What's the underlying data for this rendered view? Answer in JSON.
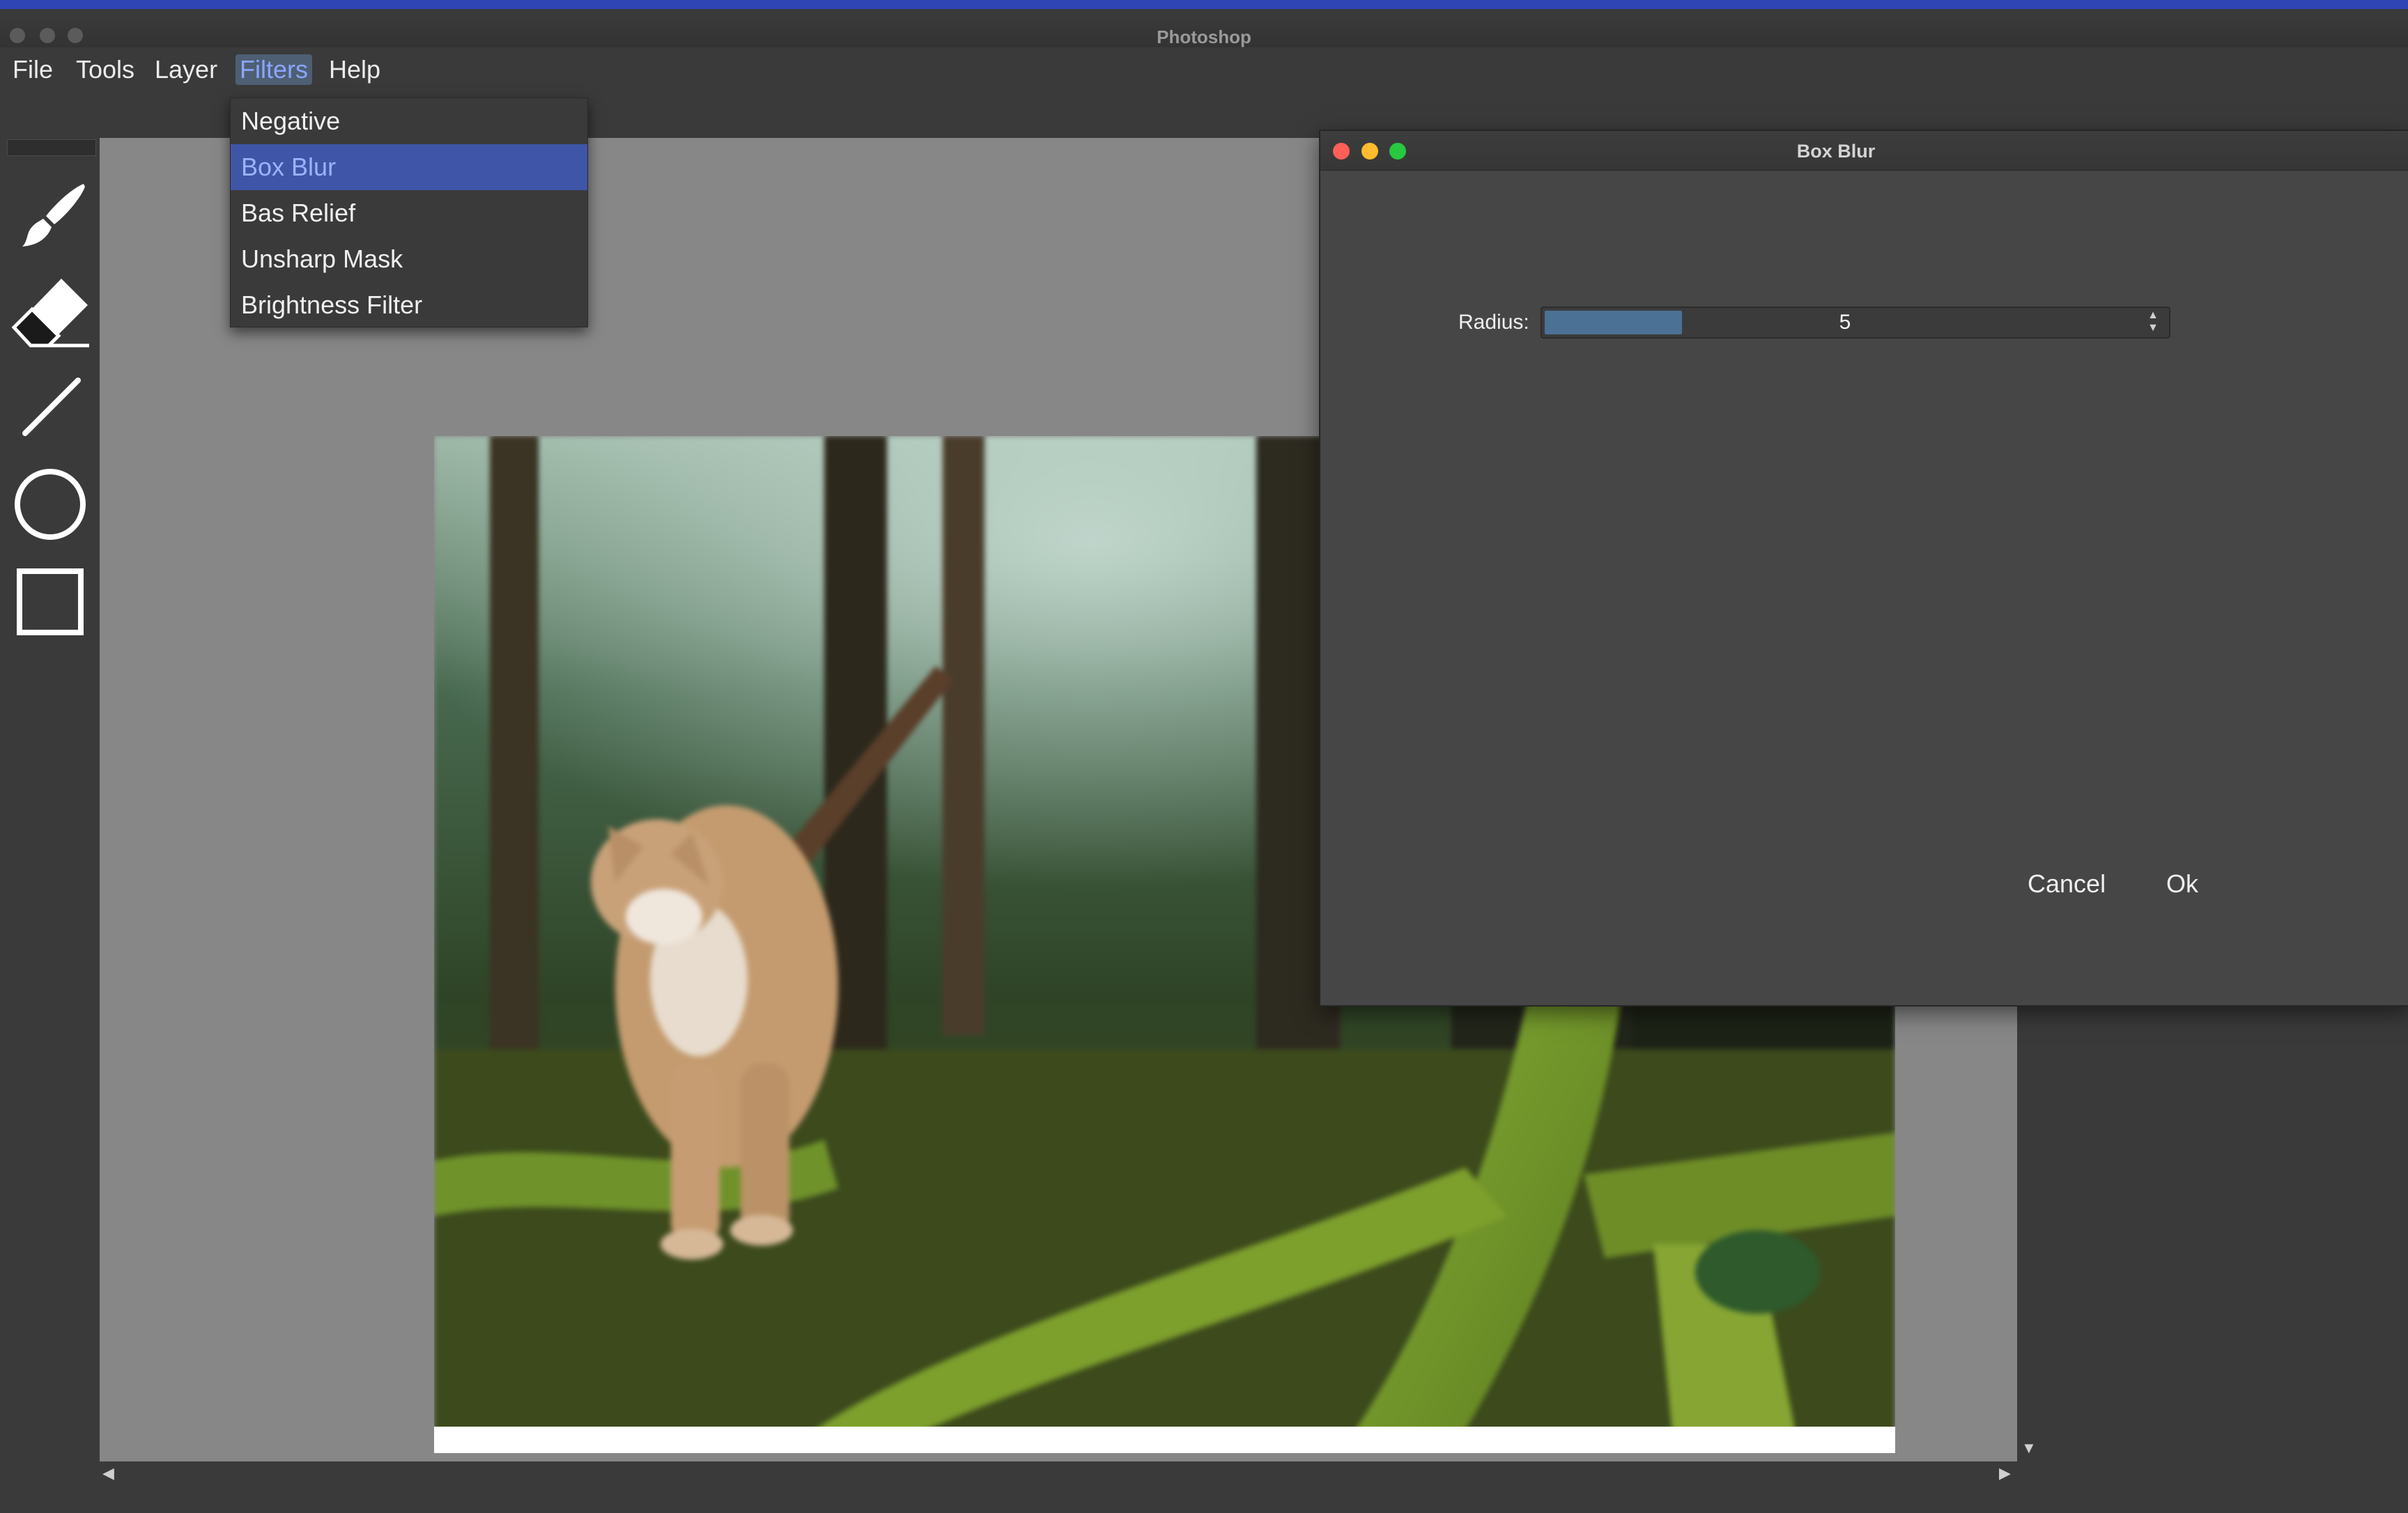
{
  "app": {
    "window_title": "Photoshop"
  },
  "menubar": {
    "items": [
      {
        "label": "File"
      },
      {
        "label": "Tools"
      },
      {
        "label": "Layer"
      },
      {
        "label": "Filters",
        "active": true
      },
      {
        "label": "Help"
      }
    ]
  },
  "filters_menu": {
    "items": [
      "Negative",
      "Box Blur",
      "Bas Relief",
      "Unsharp Mask",
      "Brightness Filter"
    ],
    "selected": "Box Blur"
  },
  "toolbar": {
    "tools": [
      "brush-icon",
      "eraser-icon",
      "line-icon",
      "ellipse-icon",
      "rectangle-icon"
    ]
  },
  "canvas": {
    "image_description_icon": "photo-image",
    "selection_color": "#3f55a8"
  },
  "dialog": {
    "title": "Box Blur",
    "radius_label": "Radius:",
    "radius_value": "5",
    "radius_fill_fraction": 0.23,
    "cancel_label": "Cancel",
    "ok_label": "Ok",
    "light_colors": {
      "close": "#ff5f57",
      "minimize": "#febc2e",
      "zoom": "#28c840"
    }
  },
  "colors": {
    "accent_blue": "#3f55a8",
    "top_strip": "#2f45b6",
    "spin_fill": "#4b7195"
  }
}
